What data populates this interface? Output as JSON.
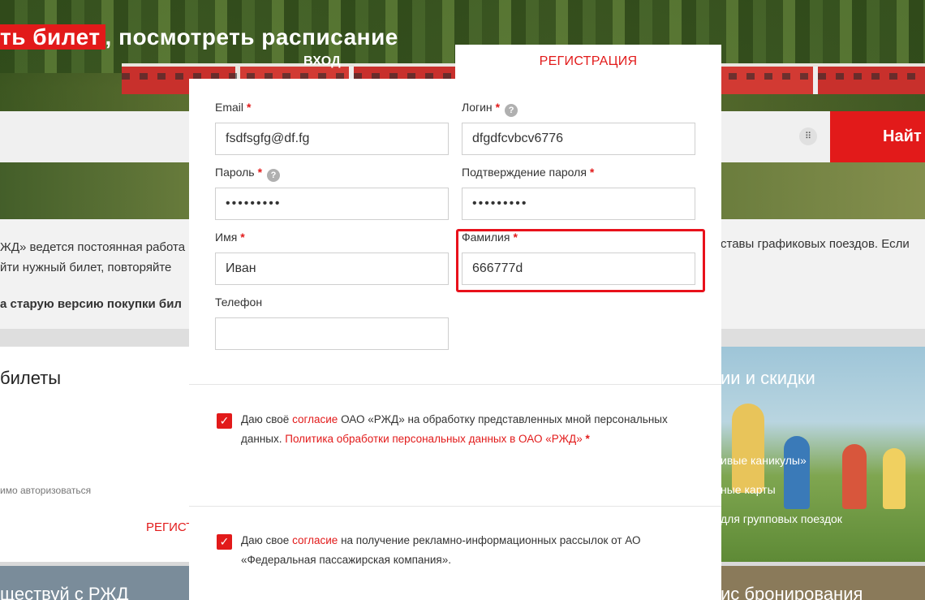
{
  "background": {
    "hero_title_red": "ть билет",
    "hero_title_rest": ", посмотреть расписание",
    "search_button": "Найт",
    "search_grid_icon": "grid-icon",
    "notice_line1": "ЖД» ведется постоянная работа",
    "notice_line2": "йти нужный билет, повторяйте",
    "notice_right": "ставы графиковых поездов. Если",
    "notice_link": "а старую версию покупки бил",
    "left_card_title": "билеты",
    "left_card_note": "имо авторизоваться",
    "left_card_register": "РЕГИСТ",
    "right_card_title": "ии и скидки",
    "right_card_items": [
      "ивые каникулы»",
      "ные карты",
      "для групповых поездок"
    ],
    "bottom_left_text": "ществуй с РЖД",
    "bottom_right_text": "ис бронирования"
  },
  "tabs": {
    "login": "ВХОД",
    "register": "РЕГИСТРАЦИЯ"
  },
  "form": {
    "email": {
      "label": "Email",
      "value": "fsdfsgfg@df.fg"
    },
    "login": {
      "label": "Логин",
      "value": "dfgdfcvbcv6776"
    },
    "password": {
      "label": "Пароль",
      "value": "•••••••••"
    },
    "password_confirm": {
      "label": "Подтверждение пароля",
      "value": "•••••••••"
    },
    "first_name": {
      "label": "Имя",
      "value": "Иван"
    },
    "last_name": {
      "label": "Фамилия",
      "value": "666777d"
    },
    "phone": {
      "label": "Телефон",
      "value": ""
    },
    "required_mark": "*",
    "help_mark": "?"
  },
  "consents": {
    "personal_data": {
      "prefix": "Даю своё ",
      "link1": "согласие",
      "middle": " ОАО «РЖД» на обработку представленных мной персональных данных. ",
      "link2": "Политика обработки персональных данных в ОАО «РЖД»",
      "required": " *",
      "checked": true
    },
    "marketing": {
      "prefix": "Даю свое ",
      "link": "согласие",
      "suffix": " на получение рекламно-информационных рассылок от АО «Федеральная пассажирская компания».",
      "checked": true
    },
    "check_glyph": "✓"
  },
  "colors": {
    "accent": "#e21a1a",
    "highlight": "#e8111b"
  }
}
